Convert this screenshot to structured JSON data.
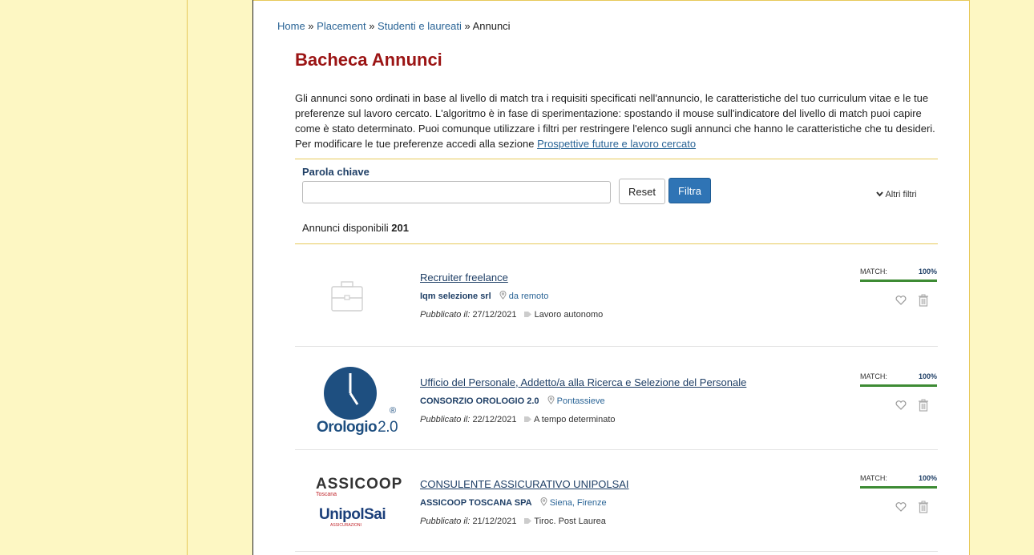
{
  "breadcrumb": {
    "home": "Home",
    "sep1": " » ",
    "placement": "Placement",
    "sep2": " » ",
    "studenti": "Studenti e laureati",
    "sep3": " » ",
    "current": "Annunci"
  },
  "page_title": "Bacheca Annunci",
  "intro": {
    "text": "Gli annunci sono ordinati in base al livello di match tra i requisiti specificati nell'annuncio, le caratteristiche del tuo curriculum vitae e le tue preferenze sul lavoro cercato. L'algoritmo è in fase di sperimentazione: spostando il mouse sull'indicatore del livello di match puoi capire come è stato determinato. Puoi comunque utilizzare i filtri per restringere l'elenco sugli annunci che hanno le caratteristiche che tu desideri. Per modificare le tue preferenze accedi alla sezione ",
    "link": "Prospettive future e lavoro cercato"
  },
  "filter": {
    "keyword_label": "Parola chiave",
    "keyword_value": "",
    "reset_label": "Reset",
    "filter_label": "Filtra",
    "more_filters_label": "Altri filtri"
  },
  "results": {
    "count_label": "Annunci disponibili ",
    "count": "201"
  },
  "jobs": [
    {
      "title": "Recruiter freelance",
      "company": "Iqm selezione srl",
      "location": "da remoto",
      "published_label": "Pubblicato il:",
      "date": "27/12/2021",
      "contract": "Lavoro autonomo",
      "match_label": "MATCH:",
      "match_pct": "100%",
      "match_value": 1.0
    },
    {
      "title": "Ufficio del Personale, Addetto/a alla Ricerca e Selezione del Personale",
      "company": "CONSORZIO OROLOGIO 2.0",
      "location": "Pontassieve",
      "published_label": "Pubblicato il:",
      "date": "22/12/2021",
      "contract": "A tempo determinato",
      "match_label": "MATCH:",
      "match_pct": "100%",
      "match_value": 1.0,
      "logo_text": "Orologio",
      "logo_version": "2.0",
      "logo_registered": "®"
    },
    {
      "title": "CONSULENTE ASSICURATIVO UNIPOLSAI",
      "company": "ASSICOOP TOSCANA SPA",
      "location": "Siena, Firenze",
      "published_label": "Pubblicato il:",
      "date": "21/12/2021",
      "contract": "Tiroc. Post Laurea",
      "match_label": "MATCH:",
      "match_pct": "100%",
      "match_value": 1.0,
      "logo_text": "ASSICOOP",
      "logo_sub": "Toscana",
      "logo_text2": "UnipolSai",
      "logo_sub2": "ASSICURAZIONI"
    }
  ],
  "colors": {
    "title": "#9b1414",
    "link": "#2a6496",
    "primary_button": "#2f74b5",
    "match_bar": "#3d8b34",
    "yellow_panel": "#fdf7c3",
    "yellow_rule": "#e7c95a"
  },
  "icons": {
    "more_filters": "chevron-down-icon",
    "location": "map-pin-icon",
    "contract": "tag-icon",
    "favorite": "heart-icon",
    "delete": "trash-icon",
    "placeholder_logo": "briefcase-icon"
  }
}
